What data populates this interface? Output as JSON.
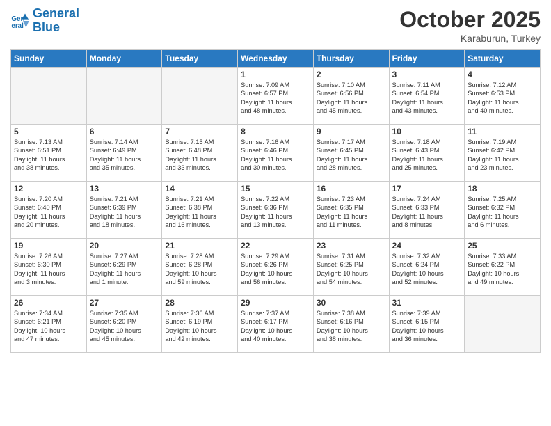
{
  "header": {
    "logo_line1": "General",
    "logo_line2": "Blue",
    "month": "October 2025",
    "location": "Karaburun, Turkey"
  },
  "weekdays": [
    "Sunday",
    "Monday",
    "Tuesday",
    "Wednesday",
    "Thursday",
    "Friday",
    "Saturday"
  ],
  "weeks": [
    [
      {
        "day": "",
        "info": ""
      },
      {
        "day": "",
        "info": ""
      },
      {
        "day": "",
        "info": ""
      },
      {
        "day": "1",
        "info": "Sunrise: 7:09 AM\nSunset: 6:57 PM\nDaylight: 11 hours\nand 48 minutes."
      },
      {
        "day": "2",
        "info": "Sunrise: 7:10 AM\nSunset: 6:56 PM\nDaylight: 11 hours\nand 45 minutes."
      },
      {
        "day": "3",
        "info": "Sunrise: 7:11 AM\nSunset: 6:54 PM\nDaylight: 11 hours\nand 43 minutes."
      },
      {
        "day": "4",
        "info": "Sunrise: 7:12 AM\nSunset: 6:53 PM\nDaylight: 11 hours\nand 40 minutes."
      }
    ],
    [
      {
        "day": "5",
        "info": "Sunrise: 7:13 AM\nSunset: 6:51 PM\nDaylight: 11 hours\nand 38 minutes."
      },
      {
        "day": "6",
        "info": "Sunrise: 7:14 AM\nSunset: 6:49 PM\nDaylight: 11 hours\nand 35 minutes."
      },
      {
        "day": "7",
        "info": "Sunrise: 7:15 AM\nSunset: 6:48 PM\nDaylight: 11 hours\nand 33 minutes."
      },
      {
        "day": "8",
        "info": "Sunrise: 7:16 AM\nSunset: 6:46 PM\nDaylight: 11 hours\nand 30 minutes."
      },
      {
        "day": "9",
        "info": "Sunrise: 7:17 AM\nSunset: 6:45 PM\nDaylight: 11 hours\nand 28 minutes."
      },
      {
        "day": "10",
        "info": "Sunrise: 7:18 AM\nSunset: 6:43 PM\nDaylight: 11 hours\nand 25 minutes."
      },
      {
        "day": "11",
        "info": "Sunrise: 7:19 AM\nSunset: 6:42 PM\nDaylight: 11 hours\nand 23 minutes."
      }
    ],
    [
      {
        "day": "12",
        "info": "Sunrise: 7:20 AM\nSunset: 6:40 PM\nDaylight: 11 hours\nand 20 minutes."
      },
      {
        "day": "13",
        "info": "Sunrise: 7:21 AM\nSunset: 6:39 PM\nDaylight: 11 hours\nand 18 minutes."
      },
      {
        "day": "14",
        "info": "Sunrise: 7:21 AM\nSunset: 6:38 PM\nDaylight: 11 hours\nand 16 minutes."
      },
      {
        "day": "15",
        "info": "Sunrise: 7:22 AM\nSunset: 6:36 PM\nDaylight: 11 hours\nand 13 minutes."
      },
      {
        "day": "16",
        "info": "Sunrise: 7:23 AM\nSunset: 6:35 PM\nDaylight: 11 hours\nand 11 minutes."
      },
      {
        "day": "17",
        "info": "Sunrise: 7:24 AM\nSunset: 6:33 PM\nDaylight: 11 hours\nand 8 minutes."
      },
      {
        "day": "18",
        "info": "Sunrise: 7:25 AM\nSunset: 6:32 PM\nDaylight: 11 hours\nand 6 minutes."
      }
    ],
    [
      {
        "day": "19",
        "info": "Sunrise: 7:26 AM\nSunset: 6:30 PM\nDaylight: 11 hours\nand 3 minutes."
      },
      {
        "day": "20",
        "info": "Sunrise: 7:27 AM\nSunset: 6:29 PM\nDaylight: 11 hours\nand 1 minute."
      },
      {
        "day": "21",
        "info": "Sunrise: 7:28 AM\nSunset: 6:28 PM\nDaylight: 10 hours\nand 59 minutes."
      },
      {
        "day": "22",
        "info": "Sunrise: 7:29 AM\nSunset: 6:26 PM\nDaylight: 10 hours\nand 56 minutes."
      },
      {
        "day": "23",
        "info": "Sunrise: 7:31 AM\nSunset: 6:25 PM\nDaylight: 10 hours\nand 54 minutes."
      },
      {
        "day": "24",
        "info": "Sunrise: 7:32 AM\nSunset: 6:24 PM\nDaylight: 10 hours\nand 52 minutes."
      },
      {
        "day": "25",
        "info": "Sunrise: 7:33 AM\nSunset: 6:22 PM\nDaylight: 10 hours\nand 49 minutes."
      }
    ],
    [
      {
        "day": "26",
        "info": "Sunrise: 7:34 AM\nSunset: 6:21 PM\nDaylight: 10 hours\nand 47 minutes."
      },
      {
        "day": "27",
        "info": "Sunrise: 7:35 AM\nSunset: 6:20 PM\nDaylight: 10 hours\nand 45 minutes."
      },
      {
        "day": "28",
        "info": "Sunrise: 7:36 AM\nSunset: 6:19 PM\nDaylight: 10 hours\nand 42 minutes."
      },
      {
        "day": "29",
        "info": "Sunrise: 7:37 AM\nSunset: 6:17 PM\nDaylight: 10 hours\nand 40 minutes."
      },
      {
        "day": "30",
        "info": "Sunrise: 7:38 AM\nSunset: 6:16 PM\nDaylight: 10 hours\nand 38 minutes."
      },
      {
        "day": "31",
        "info": "Sunrise: 7:39 AM\nSunset: 6:15 PM\nDaylight: 10 hours\nand 36 minutes."
      },
      {
        "day": "",
        "info": ""
      }
    ]
  ]
}
